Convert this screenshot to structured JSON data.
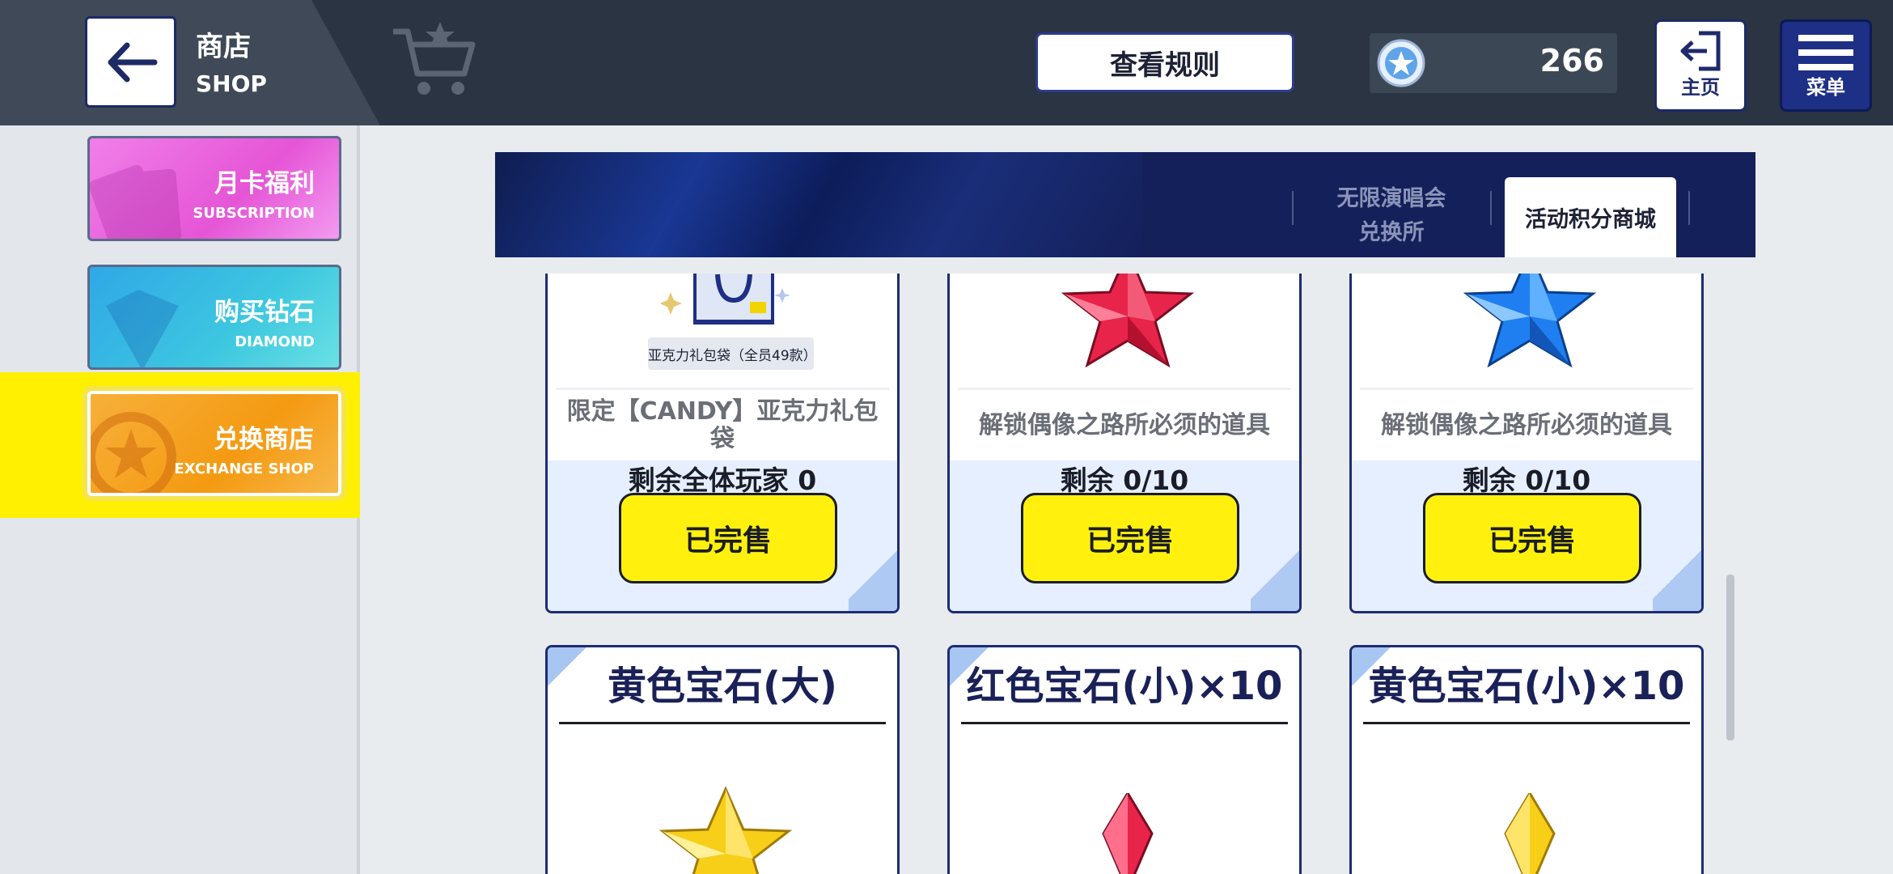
{
  "header": {
    "shop_title": "商店",
    "shop_subtitle": "SHOP",
    "rules_button": "查看规则",
    "currency_value": "266",
    "home_label": "主页",
    "menu_label": "菜单"
  },
  "sidebar": {
    "items": [
      {
        "title": "月卡福利",
        "subtitle": "SUBSCRIPTION"
      },
      {
        "title": "购买钻石",
        "subtitle": "DIAMOND"
      },
      {
        "title": "兑换商店",
        "subtitle": "EXCHANGE SHOP"
      }
    ]
  },
  "tabs": {
    "inactive_line1": "无限演唱会",
    "inactive_line2": "兑换所",
    "active": "活动积分商城"
  },
  "cards_top": [
    {
      "desc": "限定【CANDY】亚克力礼包袋",
      "remain": "剩余全体玩家 0",
      "button": "已完售",
      "label": "亚克力礼包袋（全员49款）"
    },
    {
      "desc": "解锁偶像之路所必须的道具",
      "remain": "剩余 0/10",
      "button": "已完售"
    },
    {
      "desc": "解锁偶像之路所必须的道具",
      "remain": "剩余 0/10",
      "button": "已完售"
    }
  ],
  "cards_bottom": [
    {
      "title": "黄色宝石(大)"
    },
    {
      "title": "红色宝石(小)×10"
    },
    {
      "title": "黄色宝石(小)×10"
    }
  ],
  "colors": {
    "accent_yellow": "#fff10d",
    "navy": "#1d2c74",
    "topbar": "#2a3442"
  }
}
